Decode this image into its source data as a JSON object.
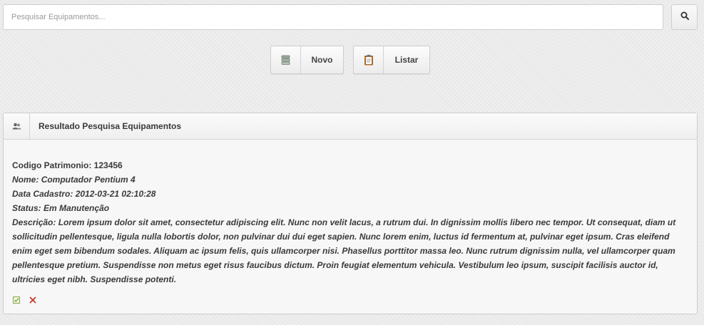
{
  "search": {
    "placeholder": "Pesquisar Equipamentos..."
  },
  "toolbar": {
    "novo_label": "Novo",
    "listar_label": "Listar"
  },
  "panel": {
    "title": "Resultado Pesquisa Equipamentos"
  },
  "result": {
    "codigo_label": "Codigo Patrimonio:",
    "codigo_value": "123456",
    "nome_label": "Nome:",
    "nome_value": "Computador Pentium 4",
    "data_label": "Data Cadastro:",
    "data_value": "2012-03-21 02:10:28",
    "status_label": "Status:",
    "status_value": "Em Manutenção",
    "descricao_label": "Descrição:",
    "descricao_value": "Lorem ipsum dolor sit amet, consectetur adipiscing elit. Nunc non velit lacus, a rutrum dui. In dignissim mollis libero nec tempor. Ut consequat, diam ut sollicitudin pellentesque, ligula nulla lobortis dolor, non pulvinar dui dui eget sapien. Nunc lorem enim, luctus id fermentum at, pulvinar eget ipsum. Cras eleifend enim eget sem bibendum sodales. Aliquam ac ipsum felis, quis ullamcorper nisi. Phasellus porttitor massa leo. Nunc rutrum dignissim nulla, vel ullamcorper quam pellentesque pretium. Suspendisse non metus eget risus faucibus dictum. Proin feugiat elementum vehicula. Vestibulum leo ipsum, suscipit facilisis auctor id, ultricies eget nibh. Suspendisse potenti."
  },
  "icons": {
    "search": "search-icon",
    "novo": "database-icon",
    "listar": "clipboard-icon",
    "panel": "users-icon",
    "edit": "edit-icon",
    "delete": "delete-icon"
  },
  "colors": {
    "edit": "#7aa52e",
    "delete": "#c0392b"
  }
}
